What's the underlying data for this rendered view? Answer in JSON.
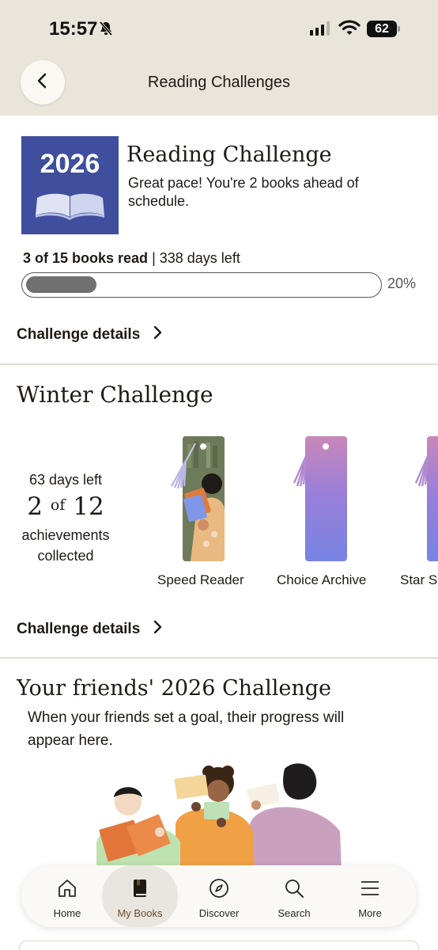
{
  "status_bar": {
    "time": "15:57",
    "battery": "62",
    "icons": [
      "bell-slash-icon",
      "signal-icon",
      "wifi-icon",
      "battery-icon"
    ]
  },
  "header": {
    "title": "Reading Challenges",
    "back_icon": "chevron-left-icon"
  },
  "reading_challenge": {
    "cover_year": "2026",
    "title": "Reading Challenge",
    "message": "Great pace! You're 2 books ahead of schedule.",
    "books_read_text": "3 of 15 books read",
    "separator": " | ",
    "days_left_text": "338 days left",
    "progress_fraction": 0.2,
    "progress_label": "20%",
    "details_label": "Challenge details"
  },
  "winter_challenge": {
    "title": "Winter Challenge",
    "days_left": "63 days left",
    "collected": "2",
    "of_word": "of",
    "total": "12",
    "collected_caption": "achievements collected",
    "badges": [
      {
        "label": "Speed Reader"
      },
      {
        "label": "Choice Archive"
      },
      {
        "label": "Star Sc"
      }
    ],
    "details_label": "Challenge details"
  },
  "friends_challenge": {
    "title": "Your friends' 2026 Challenge",
    "message": "When your friends set a goal, their progress will appear here."
  },
  "tab_bar": {
    "tabs": [
      {
        "label": "Home",
        "icon": "home-icon"
      },
      {
        "label": "My Books",
        "icon": "my-books-icon",
        "active": true
      },
      {
        "label": "Discover",
        "icon": "compass-icon"
      },
      {
        "label": "Search",
        "icon": "search-icon"
      },
      {
        "label": "More",
        "icon": "menu-icon"
      }
    ]
  },
  "colors": {
    "header_bg": "#e9e5da",
    "cover_blue": "#3f4f9d",
    "progress_fill": "#707070",
    "active_tab_bg": "#e9e6df"
  }
}
